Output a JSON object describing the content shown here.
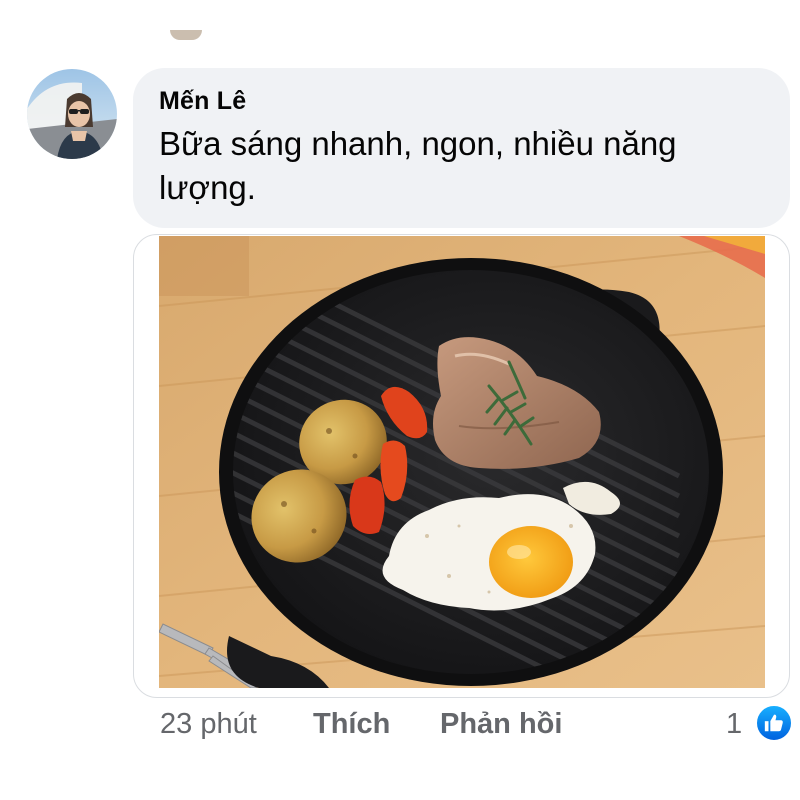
{
  "comment": {
    "author": "Mến Lê",
    "text": "Bữa sáng nhanh, ngon, nhiều năng lượng.",
    "avatar_icon": "profile-photo",
    "photo": "breakfast-on-grill-pan"
  },
  "actions": {
    "timestamp": "23 phút",
    "like_label": "Thích",
    "reply_label": "Phản hồi"
  },
  "reactions": {
    "count": "1",
    "icon": "like-thumbs-up-icon",
    "color": "#1877f2"
  },
  "colors": {
    "bubble_background": "#f0f2f5",
    "text_primary": "#050505",
    "text_secondary": "#65676b"
  }
}
